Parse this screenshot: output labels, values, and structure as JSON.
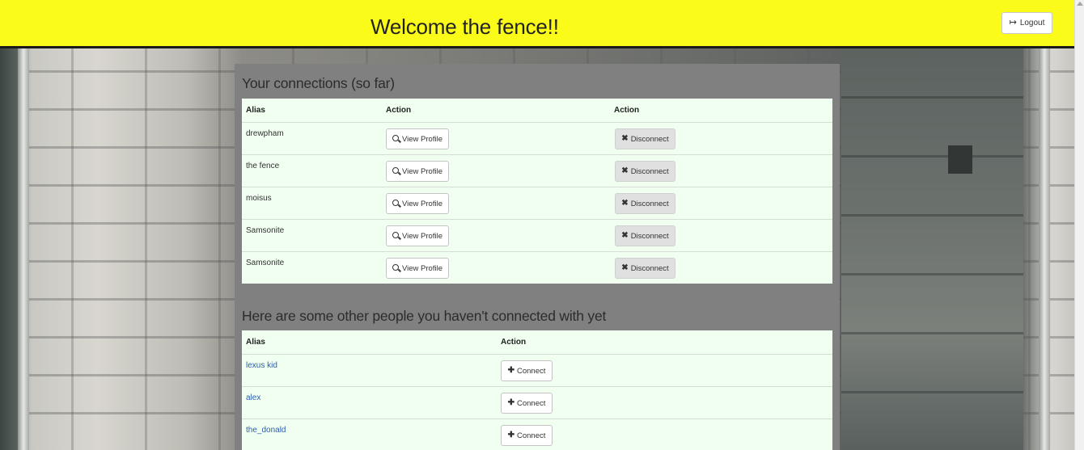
{
  "header": {
    "title": "Welcome the fence!!",
    "logout_label": "Logout",
    "logout_icon": "logout-icon",
    "background_color": "#fbfb19"
  },
  "connections": {
    "title": "Your connections (so far)",
    "columns": [
      "Alias",
      "Action",
      "Action"
    ],
    "view_label": "View Profile",
    "disconnect_label": "Disconnect",
    "rows": [
      {
        "alias": "drewpham"
      },
      {
        "alias": "the fence"
      },
      {
        "alias": "moisus"
      },
      {
        "alias": "Samsonite"
      },
      {
        "alias": "Samsonite"
      }
    ]
  },
  "others": {
    "title": "Here are some other people you haven't connected with yet",
    "columns": [
      "Alias",
      "Action"
    ],
    "connect_label": "Connect",
    "rows": [
      {
        "alias": "lexus kid"
      },
      {
        "alias": "alex"
      },
      {
        "alias": "the_donald"
      }
    ]
  },
  "colors": {
    "panel": "#808080",
    "table_bg": "#f0fff0",
    "link": "#2a5db0"
  }
}
